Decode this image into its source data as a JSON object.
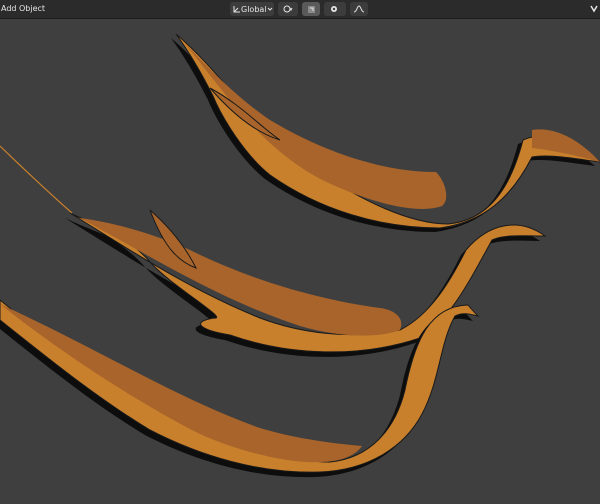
{
  "header": {
    "menu": {
      "add_label": "Add",
      "object_label": "Object"
    },
    "transform_orientation": {
      "value": "Global"
    }
  },
  "viewport": {
    "background_color": "#3f3f3f",
    "object_fill_color": "#c9802c",
    "object_shade_color": "#a8642a",
    "outline_color": "#0d0d0d",
    "object_count": 3
  }
}
